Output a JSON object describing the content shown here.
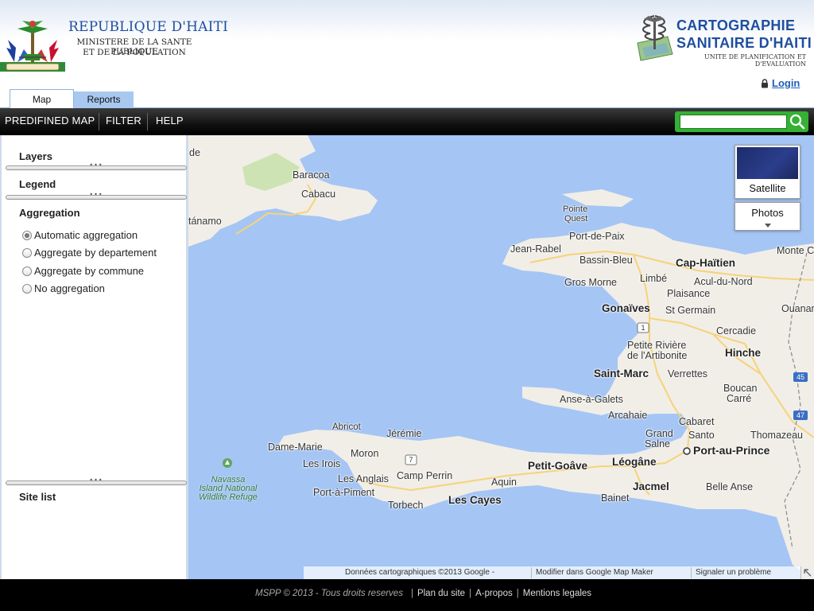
{
  "header": {
    "republic_title": "REPUBLIQUE D'HAITI",
    "ministry_line1": "MINISTERE DE LA SANTE PUBLIQUE",
    "ministry_line2": "ET DE LA POPULATION",
    "carto_title1": "CARTOGRAPHIE",
    "carto_title2": "SANITAIRE D'HAITI",
    "carto_subtitle": "UNITE DE PLANIFICATION ET D'EVALUATION",
    "login_label": "Login"
  },
  "tabs": [
    {
      "label": "Map",
      "active": true
    },
    {
      "label": "Reports",
      "active": false
    }
  ],
  "toolbar": {
    "items": [
      "PREDIFINED MAP",
      "FILTER",
      "HELP"
    ],
    "search_value": "",
    "search_placeholder": ""
  },
  "sidebar": {
    "layers_title": "Layers",
    "legend_title": "Legend",
    "aggregation_title": "Aggregation",
    "aggregation_options": [
      {
        "label": "Automatic aggregation",
        "checked": true
      },
      {
        "label": "Aggregate by departement",
        "checked": false
      },
      {
        "label": "Aggregate by commune",
        "checked": false
      },
      {
        "label": "No aggregation",
        "checked": false
      }
    ],
    "site_list_title": "Site list",
    "splitter_glyph": "•••"
  },
  "map": {
    "satellite_label": "Satellite",
    "photos_label": "Photos",
    "attribution_data": "Données cartographiques ©2013 Google -",
    "attribution_mapmaker": "Modifier dans Google Map Maker",
    "attribution_report": "Signaler un problème",
    "places": {
      "de": "de",
      "baracoa": "Baracoa",
      "cabacu": "Cabacu",
      "tanamo": "tánamo",
      "pointe_quest_1": "Pointe",
      "pointe_quest_2": "Quest",
      "port_de_paix": "Port-de-Paix",
      "jean_rabel": "Jean-Rabel",
      "bassin_bleu": "Bassin-Bleu",
      "monte_c": "Monte C",
      "cap_haitien": "Cap-Haïtien",
      "gros_morne": "Gros Morne",
      "limbe": "Limbé",
      "acul_du_nord": "Acul-du-Nord",
      "plaisance": "Plaisance",
      "gonaives": "Gonaïves",
      "st_germain": "St Germain",
      "ouanamint": "Ouanamint",
      "cercadie": "Cercadie",
      "petite_riviere_1": "Petite Rivière",
      "petite_riviere_2": "de l'Artibonite",
      "hinche": "Hinche",
      "saint_marc": "Saint-Marc",
      "verrettes": "Verrettes",
      "boucan_carre_1": "Boucan",
      "boucan_carre_2": "Carré",
      "anse_a_galets": "Anse-à-Galets",
      "arcahaie": "Arcahaie",
      "cabaret": "Cabaret",
      "abricot": "Abricot",
      "jeremie": "Jérémie",
      "grand_salne_1": "Grand",
      "grand_salne_2": "Salne",
      "santo": "Santo",
      "thomazeau": "Thomazeau",
      "dame_marie": "Dame-Marie",
      "moron": "Moron",
      "port_au_prince": "Port-au-Prince",
      "les_irois": "Les Irois",
      "petit_goave": "Petit-Goâve",
      "leogane": "Léogâne",
      "navassa_1": "Navassa",
      "navassa_2": "Island National",
      "navassa_3": "Wildlife Refuge",
      "les_anglais": "Les Anglais",
      "camp_perrin": "Camp Perrin",
      "aquin": "Aquin",
      "jacmel": "Jacmel",
      "belle_anse": "Belle Anse",
      "port_a_piment": "Port-à-Piment",
      "bainet": "Bainet",
      "torbech": "Torbech",
      "les_cayes": "Les Cayes"
    },
    "road_shields": [
      "1",
      "7",
      "45",
      "47"
    ]
  },
  "footer": {
    "copyright": "MSPP © 2013 - Tous droits reserves",
    "links": [
      "Plan du site",
      "A-propos",
      "Mentions legales"
    ]
  },
  "colors": {
    "brand_blue": "#1f4e9e",
    "tab_inactive": "#a9c8f0",
    "search_green": "#35b135",
    "water": "#a5c5f4",
    "land": "#f1eee7"
  }
}
